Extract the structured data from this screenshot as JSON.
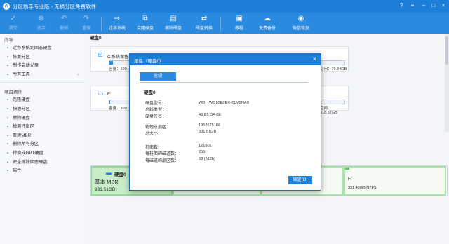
{
  "window": {
    "title": "分区助手专业版 - 无损分区免费软件",
    "logo": "A"
  },
  "toolbar": [
    {
      "label": "提交",
      "icon": "check-icon",
      "glyph": "✓",
      "disabled": true
    },
    {
      "label": "放弃",
      "icon": "cancel-icon",
      "glyph": "⊗",
      "disabled": true
    },
    {
      "label": "撤销",
      "icon": "undo-icon",
      "glyph": "↶",
      "disabled": true
    },
    {
      "label": "重做",
      "icon": "redo-icon",
      "glyph": "↷",
      "disabled": true
    },
    {
      "label": "迁移系统",
      "icon": "migrate-os-icon",
      "glyph": "⇨"
    },
    {
      "label": "克隆硬盘",
      "icon": "clone-disk-icon",
      "glyph": "⧉"
    },
    {
      "label": "擦除磁盘",
      "icon": "wipe-disk-icon",
      "glyph": "▤"
    },
    {
      "label": "磁盘转换",
      "icon": "convert-disk-icon",
      "glyph": "⇄"
    },
    {
      "label": "教程",
      "icon": "tutorial-icon",
      "glyph": "▣"
    },
    {
      "label": "免费备份",
      "icon": "backup-icon",
      "glyph": "☁"
    },
    {
      "label": "微信恢复",
      "icon": "wechat-recovery-icon",
      "glyph": "◉"
    }
  ],
  "sidebar": {
    "wizard_title": "向导",
    "wizard": [
      {
        "label": "迁移系统到固态硬盘",
        "icon": "migrate-icon"
      },
      {
        "label": "恢复分区",
        "icon": "recover-icon"
      },
      {
        "label": "制作启动光盘",
        "icon": "bootdisc-icon"
      },
      {
        "label": "所有工具",
        "icon": "tools-icon",
        "arrow": "›"
      }
    ],
    "disk_ops_title": "硬盘操作",
    "disk_ops": [
      {
        "label": "克隆硬盘",
        "icon": "clone-icon"
      },
      {
        "label": "快速分区",
        "icon": "quick-partition-icon"
      },
      {
        "label": "擦除硬盘",
        "icon": "wipe-icon"
      },
      {
        "label": "检测坏扇区",
        "icon": "bad-sector-icon"
      },
      {
        "label": "重建MBR",
        "icon": "rebuild-mbr-icon"
      },
      {
        "label": "删除所有分区",
        "icon": "delete-all-icon"
      },
      {
        "label": "转换成GPT硬盘",
        "icon": "convert-gpt-icon"
      },
      {
        "label": "安全擦除固态硬盘",
        "icon": "ssd-erase-icon"
      },
      {
        "label": "属性",
        "icon": "properties-icon"
      }
    ]
  },
  "main": {
    "disk_heading": "硬盘0",
    "partitions": [
      {
        "name": "C:系统保留",
        "capacity": "容量：100...",
        "free": "空闲：79.84GB",
        "fill": 0.15
      },
      {
        "name": "E:",
        "capacity": "容量：300...",
        "free": "空闲：318.57GB",
        "fill": 0.03
      }
    ],
    "diskmap": {
      "name": "硬盘0",
      "type": "基本 MBR",
      "size": "931.51GB",
      "last_part": {
        "name": "F:",
        "detail": "331.49GB NTFS"
      }
    }
  },
  "dialog": {
    "title": "属性（硬盘0）",
    "tab": "常规",
    "heading": "硬盘0",
    "rows": [
      {
        "label": "硬盘型号：",
        "value": "WD　WD10EZEX-21M2NA0"
      },
      {
        "label": "总线类型：",
        "value": ""
      },
      {
        "label": "硬盘签名：",
        "value": "48 B5 DA 0E"
      },
      {
        "label": "物理总扇区：",
        "value": "1953525168"
      },
      {
        "label": "总大小：",
        "value": "931.51GB"
      },
      {
        "label": "柱面数：",
        "value": "121601"
      },
      {
        "label": "每柱面的磁道数：",
        "value": "255"
      },
      {
        "label": "每磁道的扇区数：",
        "value": "63 (512b)"
      }
    ],
    "ok_label": "确定(O)"
  }
}
